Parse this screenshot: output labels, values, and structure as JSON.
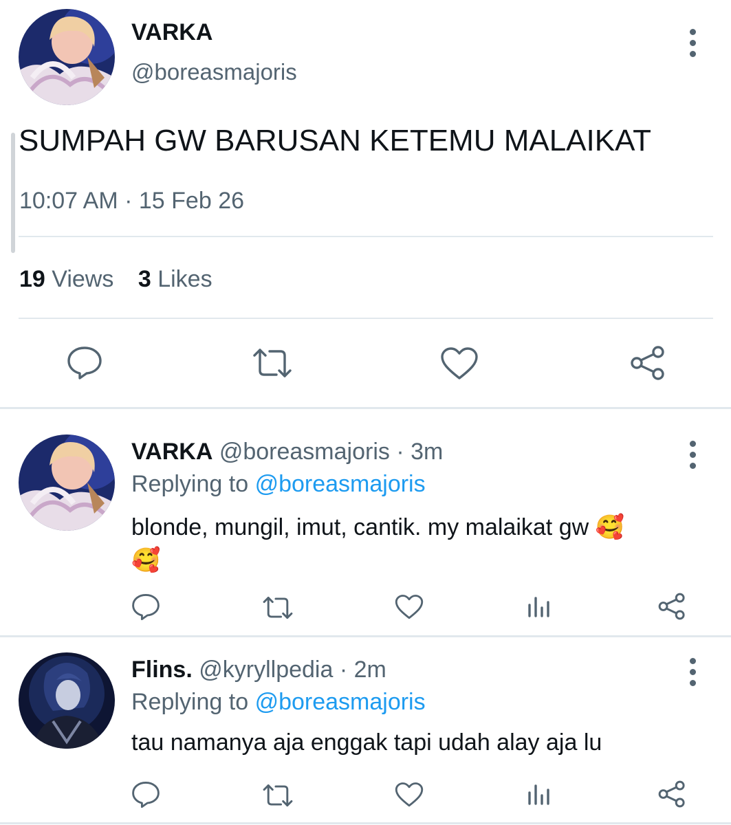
{
  "main_tweet": {
    "display_name": "VARKA",
    "handle": "@boreasmajoris",
    "text": "SUMPAH GW BARUSAN KETEMU MALAIKAT",
    "time": "10:07 AM",
    "separator": "·",
    "date": "15 Feb 26",
    "views_count": "19",
    "views_label": "Views",
    "likes_count": "3",
    "likes_label": "Likes"
  },
  "replies": [
    {
      "display_name": "VARKA",
      "handle": "@boreasmajoris",
      "separator": "·",
      "time": "3m",
      "replying_prefix": "Replying to",
      "replying_to": "@boreasmajoris",
      "text_line1": "blonde, mungil, imut, cantik. my malaikat gw 🥰",
      "text_line2": "🥰"
    },
    {
      "display_name": "Flins.",
      "handle": "@kyryllpedia",
      "separator": "·",
      "time": "2m",
      "replying_prefix": "Replying to",
      "replying_to": "@boreasmajoris",
      "text_line1": "tau namanya aja enggak tapi udah alay aja lu"
    }
  ],
  "icons": {
    "reply": "reply-icon",
    "retweet": "retweet-icon",
    "like": "heart-icon",
    "views": "views-icon",
    "share": "share-icon",
    "more": "more-icon"
  },
  "colors": {
    "text": "#0f1419",
    "secondary": "#536471",
    "link": "#1d9bf0",
    "divider": "#e1e8ed"
  }
}
